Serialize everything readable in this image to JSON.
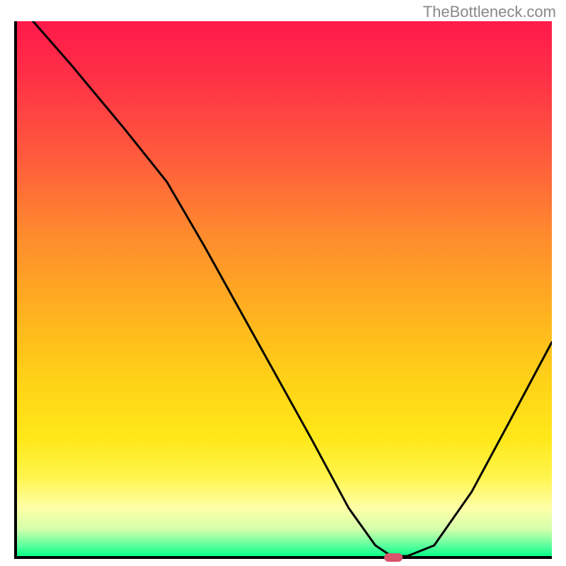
{
  "watermark": "TheBottleneck.com",
  "chart_data": {
    "type": "line",
    "title": "",
    "xlabel": "",
    "ylabel": "",
    "xlim": [
      0,
      100
    ],
    "ylim": [
      0,
      100
    ],
    "grid": false,
    "legend": false,
    "series": [
      {
        "name": "curve",
        "x": [
          3,
          10,
          20,
          28,
          35,
          45,
          55,
          62,
          67,
          70,
          73,
          78,
          85,
          92,
          100
        ],
        "y": [
          100,
          92,
          80,
          70,
          58,
          40,
          22,
          9,
          2,
          0,
          0,
          2,
          12,
          25,
          40
        ]
      }
    ],
    "marker": {
      "x": 70,
      "y": 0,
      "color": "#d9536b"
    },
    "background_gradient": {
      "stops": [
        {
          "pos": 0,
          "color": "#ff1a4a"
        },
        {
          "pos": 25,
          "color": "#ff5a3d"
        },
        {
          "pos": 55,
          "color": "#ffb31f"
        },
        {
          "pos": 78,
          "color": "#ffe81a"
        },
        {
          "pos": 95,
          "color": "#d3ffab"
        },
        {
          "pos": 100,
          "color": "#08ff88"
        }
      ]
    }
  }
}
